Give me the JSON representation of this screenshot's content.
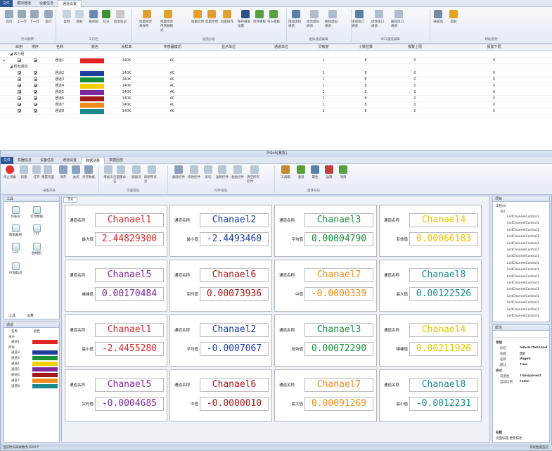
{
  "top": {
    "tabs": [
      "文件",
      "模拟通道",
      "设备信息",
      "通道设置"
    ],
    "buttons": [
      {
        "label": "首行",
        "color": "#9aa7b8"
      },
      {
        "label": "上一行",
        "color": "#9aa7b8"
      },
      {
        "label": "下一行",
        "color": "#9aa7b8"
      },
      {
        "label": "尾行",
        "color": "#9aa7b8"
      },
      {
        "label": "复制",
        "color": "#c8d3e0"
      },
      {
        "label": "粘贴",
        "color": "#c8d3e0"
      },
      {
        "label": "格式刷",
        "color": "#6c86ad"
      },
      {
        "label": "标记",
        "color": "#3f8f2f"
      },
      {
        "label": "取消标记",
        "color": "#c8c8c8"
      },
      {
        "label": "批量修改采样率",
        "color": "#e0a030"
      },
      {
        "label": "批量修改传感器模式",
        "color": "#e0a030"
      },
      {
        "label": "批量启用",
        "color": "#e0a030"
      },
      {
        "label": "批量停用",
        "color": "#e0a030"
      },
      {
        "label": "批量操作",
        "color": "#e0a030"
      },
      {
        "label": "保存通道设置",
        "color": "#2e4f8a"
      },
      {
        "label": "另存模板",
        "color": "#5aa040"
      },
      {
        "label": "导入模板",
        "color": "#5aa040"
      },
      {
        "label": "增加虚拟通道",
        "color": "#5c7fa8"
      },
      {
        "label": "修改虚拟通道",
        "color": "#b0bcc9"
      },
      {
        "label": "删除虚拟通道",
        "color": "#b0bcc9"
      },
      {
        "label": "增加串口通道",
        "color": "#5c7fa8"
      },
      {
        "label": "修改串口通道",
        "color": "#b0bcc9"
      },
      {
        "label": "删除串口通道",
        "color": "#b0bcc9"
      },
      {
        "label": "通道测",
        "color": "#7a8aa0"
      },
      {
        "label": "帮助",
        "color": "#e8a020"
      }
    ],
    "groups": [
      "行间跳转",
      "工作栏",
      "通道分组",
      "虚拟通道编辑",
      "串口通道编辑",
      "帮助说明"
    ],
    "columns": [
      "启用",
      "排序",
      "名称",
      "颜色",
      "采样率",
      "传感器模式",
      "显示单位",
      "通道单位",
      "灵敏度",
      "小数位数",
      "报警上限",
      "报警下限"
    ],
    "group_rows": [
      "未分组",
      "所有通道"
    ],
    "rows": [
      {
        "name": "通道1",
        "color": "#e02424",
        "rate": "140K",
        "mode": "AC",
        "sens": "1",
        "dec": "8",
        "hi": "0",
        "lo": "0"
      },
      {
        "name": "通道2",
        "color": "#1f3e9e",
        "rate": "140K",
        "mode": "AC",
        "sens": "1",
        "dec": "8",
        "hi": "0",
        "lo": "0"
      },
      {
        "name": "通道3",
        "color": "#1a8f3a",
        "rate": "140K",
        "mode": "AC",
        "sens": "1",
        "dec": "8",
        "hi": "0",
        "lo": "0"
      },
      {
        "name": "通道4",
        "color": "#f0d000",
        "rate": "140K",
        "mode": "AC",
        "sens": "1",
        "dec": "8",
        "hi": "0",
        "lo": "0"
      },
      {
        "name": "通道5",
        "color": "#7a2a9a",
        "rate": "140K",
        "mode": "AC",
        "sens": "1",
        "dec": "8",
        "hi": "0",
        "lo": "0"
      },
      {
        "name": "通道6",
        "color": "#a01818",
        "rate": "140K",
        "mode": "AC",
        "sens": "1",
        "dec": "8",
        "hi": "0",
        "lo": "0"
      },
      {
        "name": "通道7",
        "color": "#f08a1a",
        "rate": "140K",
        "mode": "AC",
        "sens": "1",
        "dec": "8",
        "hi": "0",
        "lo": "0"
      },
      {
        "name": "通道8",
        "color": "#1b8a8a",
        "rate": "140K",
        "mode": "AC",
        "sens": "1",
        "dec": "8",
        "hi": "0",
        "lo": "0"
      }
    ]
  },
  "win": {
    "title": "PtSoft[某机]",
    "tabs": [
      "文件",
      "机器信息",
      "设备信息",
      "通道设置",
      "数据测量",
      "数据回放"
    ],
    "buttons": [
      {
        "label": "停止采集",
        "color": "#e03030"
      },
      {
        "label": "新建",
        "color": "#b9c6d6"
      },
      {
        "label": "打开",
        "color": "#b9c6d6"
      },
      {
        "label": "重置页面",
        "color": "#b9c6d6"
      },
      {
        "label": "保存",
        "color": "#8aa0bb"
      },
      {
        "label": "关闭",
        "color": "#8aa0bb"
      },
      {
        "label": "另存数据",
        "color": "#8aa0bb"
      },
      {
        "label": "增加页",
        "color": "#b9c6d6"
      },
      {
        "label": "页面重命名",
        "color": "#b9c6d6"
      },
      {
        "label": "删除页",
        "color": "#b9c6d6"
      },
      {
        "label": "刷新所有页",
        "color": "#b9c6d6"
      },
      {
        "label": "删除控件",
        "color": "#8aa0bb"
      },
      {
        "label": "修改控件",
        "color": "#b9c6d6"
      },
      {
        "label": "剪切",
        "color": "#b9c6d6"
      },
      {
        "label": "复制控件",
        "color": "#b9c6d6"
      },
      {
        "label": "粘贴控件",
        "color": "#b9c6d6"
      },
      {
        "label": "清空所有控件",
        "color": "#b9c6d6"
      },
      {
        "label": "工具箱",
        "color": "#c08a30"
      },
      {
        "label": "通道",
        "color": "#5aa040"
      },
      {
        "label": "属性",
        "color": "#5c7fa8"
      },
      {
        "label": "运算",
        "color": "#c04040"
      },
      {
        "label": "项目",
        "color": "#5aa040"
      }
    ],
    "groups": [
      "采集开关",
      "页面管理",
      "控件管理",
      "窗体布局"
    ],
    "toolbox": {
      "title": "工具",
      "items": [
        "列表仪",
        "实时数据",
        "数据曲线",
        "FFT",
        "Led",
        "曲线图",
        "XY轴轨迹"
      ],
      "footer_tabs": [
        "工具",
        "运算"
      ]
    },
    "channel_panel": {
      "title": "通道",
      "cols": [
        "名称",
        "颜色"
      ],
      "groups": [
        "未分",
        "所有"
      ],
      "items": [
        "通道1",
        "通道2",
        "通道3",
        "通道4",
        "通道5",
        "通道6",
        "通道7",
        "通道8"
      ]
    },
    "page_tab": "页0",
    "project": {
      "title": "项目",
      "root": "工程(0)",
      "page": "页0",
      "items": [
        "LedChannelControl1",
        "LedChannelControl1",
        "LedChannelControl1",
        "LedChannelControl1",
        "LedChannelControl1",
        "LedChannelControl1",
        "LedChannelControl1",
        "LedChannelControl1",
        "LedChannelControl1",
        "LedChannelControl1",
        "LedChannelControl1",
        "LedChannelControl1",
        "LedChannelControl1",
        "LedChannelControl1",
        "LedChannelControl1",
        "LedChannelControl1"
      ]
    },
    "props": {
      "title": "属性",
      "sections": [
        "常规",
        "样式"
      ],
      "rows": [
        [
          "标记",
          "546cb7f6014ed"
        ],
        [
          "标题",
          "页0"
        ],
        [
          "名称",
          "Page0"
        ],
        [
          "默认",
          "True"
        ],
        [
          "背景色",
          "Transparent"
        ],
        [
          "自动比例",
          "False"
        ]
      ],
      "help_title": "标题",
      "help_text": "页面标题,便笺描述"
    },
    "status": "当前时间采样数为1500个",
    "status_right": "系统性能监控",
    "cards": [
      {
        "ch": "Chanael1",
        "label": "最大值",
        "val": "2.44829300",
        "color": "#d42a2a"
      },
      {
        "ch": "Chanael2",
        "label": "最小值",
        "val": "-2.4493460",
        "color": "#1f3e9e"
      },
      {
        "ch": "Chanael3",
        "label": "平均值",
        "val": "0.00004790",
        "color": "#1a8f3a"
      },
      {
        "ch": "Chanael4",
        "label": "有效值",
        "val": "0.00066183",
        "color": "#e6c400"
      },
      {
        "ch": "Chanael5",
        "label": "峰峰值",
        "val": "0.00170484",
        "color": "#7a2a9a"
      },
      {
        "ch": "Chanael6",
        "label": "实时值",
        "val": "0.00073936",
        "color": "#a01818"
      },
      {
        "ch": "Chanael7",
        "label": "中值",
        "val": "-0.0000339",
        "color": "#f08a1a"
      },
      {
        "ch": "Chanael8",
        "label": "最大值",
        "val": "0.00122526",
        "color": "#1b8a8a"
      },
      {
        "ch": "Chanael1",
        "label": "最小值",
        "val": "-2.4455280",
        "color": "#d42a2a"
      },
      {
        "ch": "Chanael2",
        "label": "平均值",
        "val": "-0.0007067",
        "color": "#1f3e9e"
      },
      {
        "ch": "Chanael3",
        "label": "有效值",
        "val": "0.00072290",
        "color": "#1a8f3a"
      },
      {
        "ch": "Chanael4",
        "label": "峰峰值",
        "val": "0.00211926",
        "color": "#e6c400"
      },
      {
        "ch": "Chanael5",
        "label": "实时值",
        "val": "-0.0004685",
        "color": "#7a2a9a"
      },
      {
        "ch": "Chanael6",
        "label": "中值",
        "val": "-0.0000010",
        "color": "#a01818"
      },
      {
        "ch": "Chanael7",
        "label": "最大值",
        "val": "0.00091269",
        "color": "#f08a1a"
      },
      {
        "ch": "Chanael8",
        "label": "最小值",
        "val": "-0.0012231",
        "color": "#1b8a8a"
      }
    ],
    "channel_label": "通道名称"
  }
}
